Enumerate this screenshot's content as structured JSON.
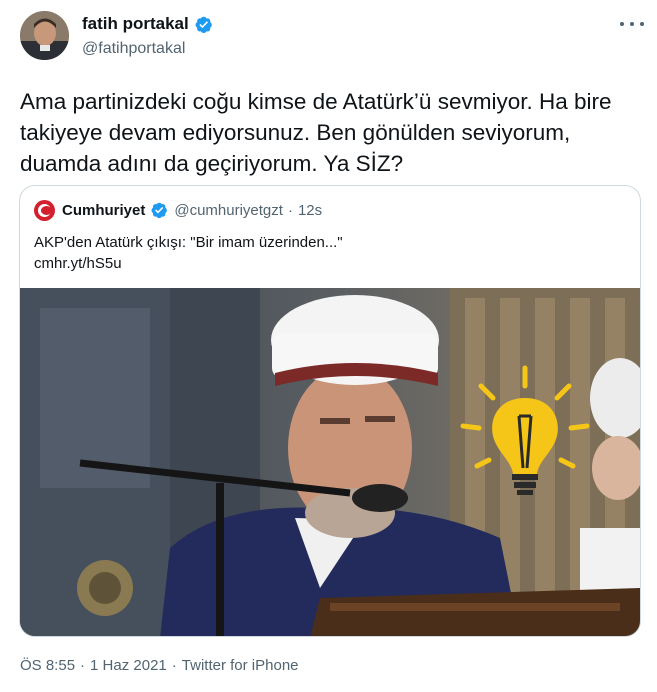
{
  "author": {
    "display_name": "fatih portakal",
    "handle": "@fatihportakal",
    "verified": true,
    "avatar_icon": "avatar-photo"
  },
  "more_icon": "more-options-icon",
  "tweet": {
    "text": "Ama partinizdeki coğu kimse de Atatürk’ü sevmiyor. Ha bire takiyeye devam ediyorsunuz. Ben gönülden seviyorum, duamda adını da geçiriyorum. Ya SİZ?"
  },
  "quote": {
    "display_name": "Cumhuriyet",
    "handle": "@cumhuriyetgzt",
    "separator": "·",
    "time": "12s",
    "verified": true,
    "text": "AKP'den Atatürk çıkışı: \"Bir imam üzerinden...\"",
    "link": "cmhr.yt/hS5u"
  },
  "footer": {
    "time": "ÖS 8:55",
    "date": "1 Haz 2021",
    "source": "Twitter for iPhone",
    "separator": "·"
  },
  "colors": {
    "text": "#0f1419",
    "secondary": "#536471",
    "verified": "#1d9bf0",
    "border": "#cfd9de",
    "brand_red": "#d3202e",
    "bulb_yellow": "#f5c518"
  }
}
